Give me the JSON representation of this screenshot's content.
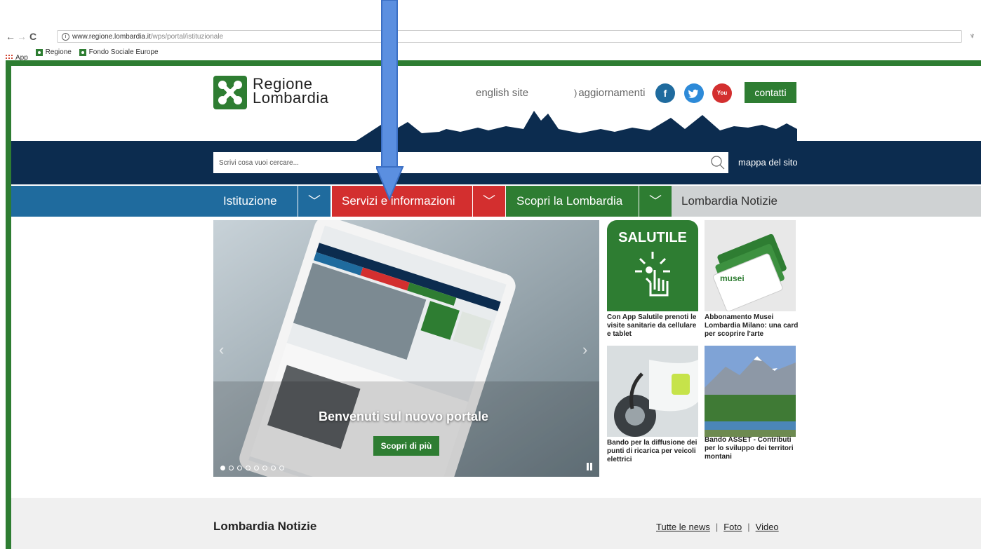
{
  "browser": {
    "url_domain": "www.regione.lombardia.it",
    "url_path": "/wps/portal/istituzionale",
    "bookmarks": [
      {
        "label": "App"
      },
      {
        "label": "Regione"
      },
      {
        "label": "Fondo Sociale Europe"
      }
    ]
  },
  "header": {
    "logo_line1": "Regione",
    "logo_line2": "Lombardia",
    "english_site": "english site",
    "aggiornamenti": "aggiornamenti",
    "social": {
      "facebook": "f",
      "youtube": "You"
    },
    "contatti": "contatti"
  },
  "search": {
    "placeholder": "Scrivi cosa vuoi cercare...",
    "mappa": "mappa del sito"
  },
  "nav": {
    "items": [
      {
        "label": "Istituzione",
        "color": "#1f6b9e"
      },
      {
        "label": "Servizi e informazioni",
        "color": "#d32f2f"
      },
      {
        "label": "Scopri la Lombardia",
        "color": "#2e7d32"
      },
      {
        "label": "Lombardia Notizie",
        "color": "#cfd2d3"
      }
    ]
  },
  "hero": {
    "title": "Benvenuti sul nuovo portale",
    "button": "Scopri di più",
    "slide_count": 8,
    "active_slide": 1
  },
  "tiles": [
    {
      "image_text": "SALUTILE",
      "caption": "Con App Salutile prenoti le visite sanitarie da cellulare e tablet"
    },
    {
      "image_text": "musei",
      "caption": "Abbonamento Musei Lombardia Milano: una card per scoprire l'arte"
    },
    {
      "caption": "Bando per la diffusione dei punti di ricarica per veicoli elettrici"
    },
    {
      "caption": "Bando ASSET - Contributi per lo sviluppo dei territori montani"
    }
  ],
  "news": {
    "title": "Lombardia Notizie",
    "links": [
      "Tutte le news",
      "Foto",
      "Video"
    ]
  },
  "colors": {
    "brand_green": "#2e7d32",
    "dark_blue": "#0c2c4f",
    "accent_blue": "#1f6b9e",
    "accent_red": "#d32f2f",
    "annotation_arrow": "#5b8fe0"
  }
}
